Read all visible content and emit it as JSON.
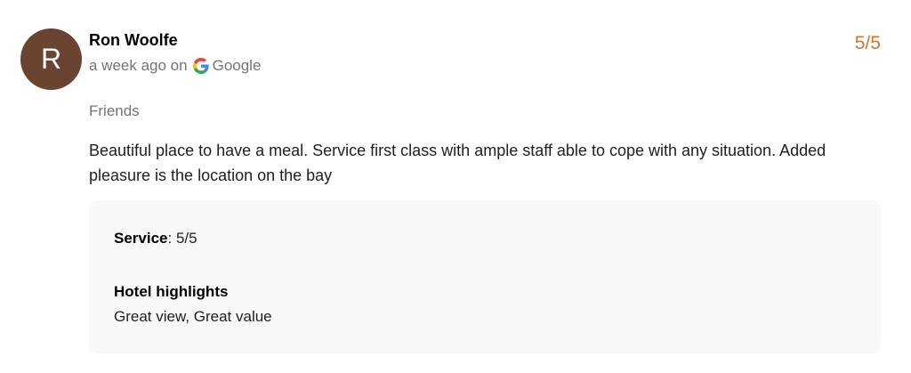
{
  "review": {
    "avatar_initial": "R",
    "avatar_color": "#6a4331",
    "author": "Ron Woolfe",
    "time_ago": "a week ago on",
    "source": "Google",
    "source_icon": "google-g-icon",
    "score": "5/5",
    "score_color": "#d1742b",
    "trip_type": "Friends",
    "text": "Beautiful place to have a meal. Service first class with ample staff able to cope with any situation. Added pleasure is the location on the bay",
    "details": {
      "service_label": "Service",
      "service_value": ": 5/5",
      "highlights_label": "Hotel highlights",
      "highlights_value": "Great view, Great value"
    }
  }
}
